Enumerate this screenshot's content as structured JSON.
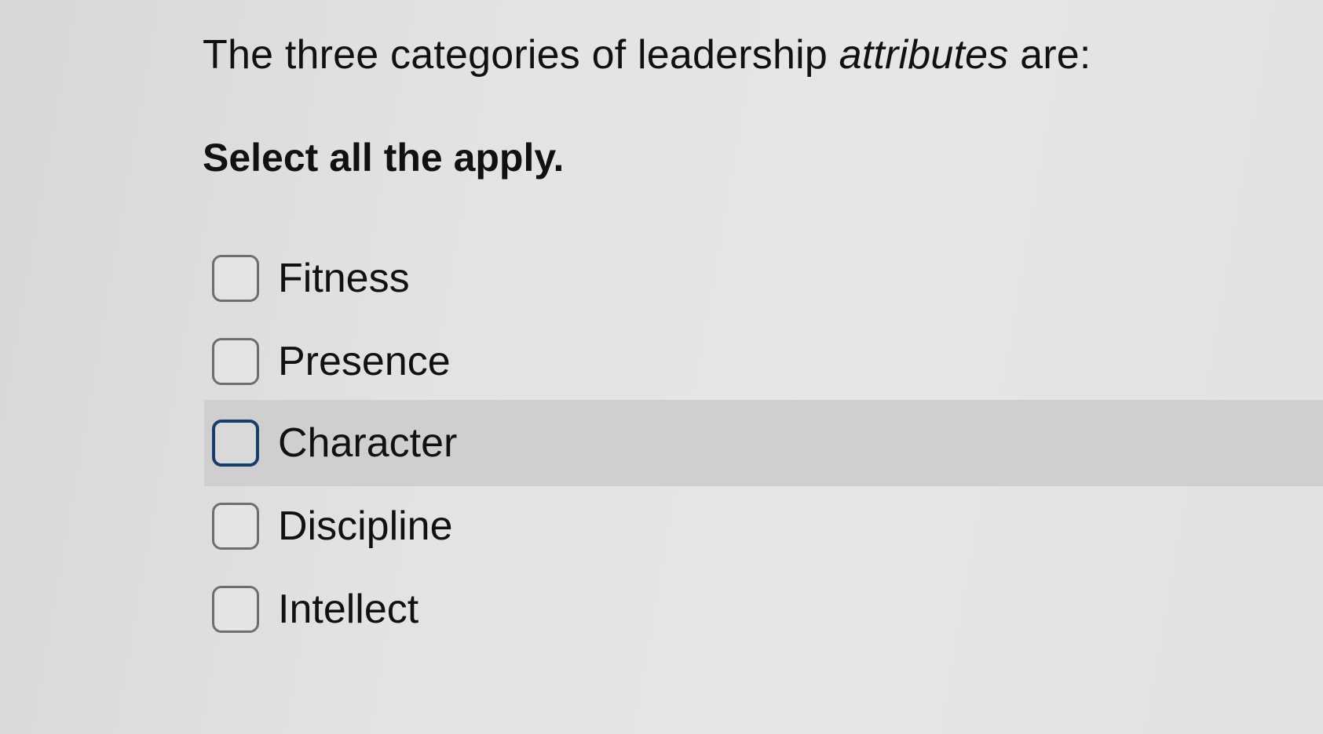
{
  "question": {
    "prefix": "The three categories of leadership ",
    "emphasis": "attributes",
    "suffix": " are:"
  },
  "instruction": "Select all the apply.",
  "options": [
    {
      "label": "Fitness",
      "checked": false
    },
    {
      "label": "Presence",
      "checked": false
    },
    {
      "label": "Character",
      "checked": false,
      "highlighted": true
    },
    {
      "label": "Discipline",
      "checked": false
    },
    {
      "label": "Intellect",
      "checked": false
    }
  ],
  "colors": {
    "background": "#e2e2e2",
    "highlight_row": "#cfcfcf",
    "focus_border": "#173e6a",
    "checkbox_border": "#6e6e6e",
    "text": "#111111"
  }
}
